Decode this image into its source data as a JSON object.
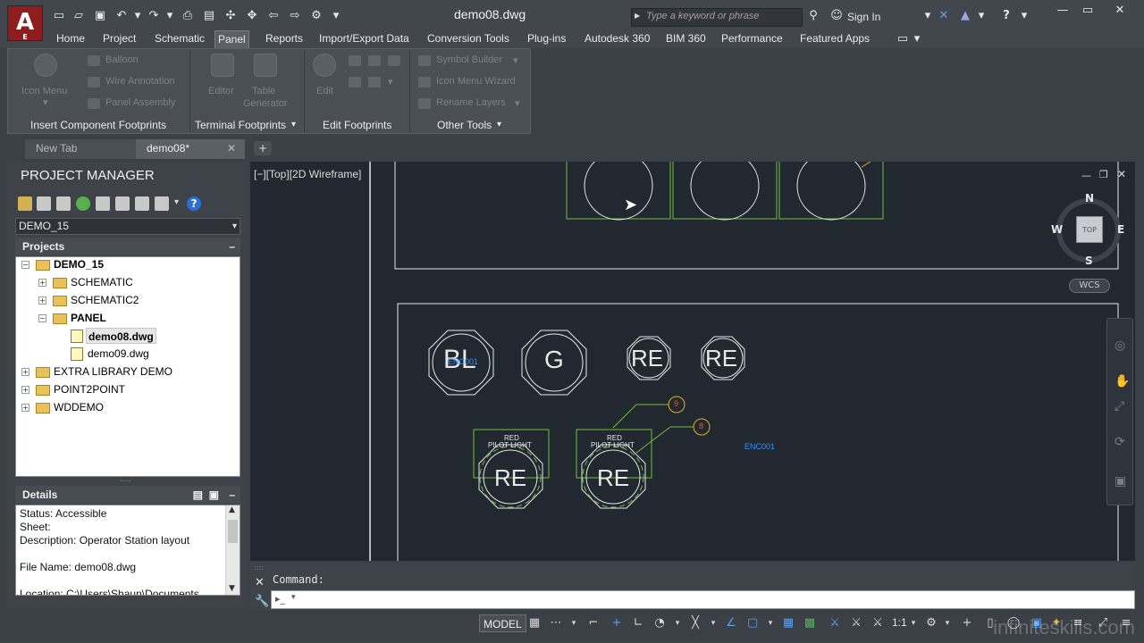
{
  "title_bar": {
    "document_title": "demo08.dwg",
    "search_placeholder": "Type a keyword or phrase",
    "sign_in_label": "Sign In",
    "app_logo_letter": "A",
    "app_logo_sub": "E"
  },
  "menu_tabs": [
    "Home",
    "Project",
    "Schematic",
    "Panel",
    "Reports",
    "Import/Export Data",
    "Conversion Tools",
    "Plug-ins",
    "Autodesk 360",
    "BIM 360",
    "Performance",
    "Featured Apps"
  ],
  "active_tab": "Panel",
  "ribbon": {
    "insert_component": {
      "title": "Insert Component Footprints",
      "icon_menu_label": "Icon Menu",
      "balloon_label": "Balloon",
      "wire_annotation_label": "Wire Annotation",
      "panel_assembly_label": "Panel Assembly"
    },
    "terminal": {
      "title": "Terminal Footprints",
      "editor_label": "Editor",
      "table_label": "Table",
      "generator_label": "Generator"
    },
    "edit": {
      "title": "Edit Footprints",
      "edit_label": "Edit"
    },
    "other": {
      "title": "Other Tools",
      "symbol_builder_label": "Symbol Builder",
      "icon_menu_wizard_label": "Icon Menu  Wizard",
      "rename_layers_label": "Rename  Layers"
    }
  },
  "file_tabs": {
    "new_tab": "New Tab",
    "active_file": "demo08*"
  },
  "project_manager": {
    "title": "PROJECT MANAGER",
    "selected_project": "DEMO_15",
    "projects_header": "Projects",
    "tree": [
      {
        "label": "DEMO_15",
        "bold": true
      },
      {
        "label": "SCHEMATIC",
        "bold": false
      },
      {
        "label": "SCHEMATIC2",
        "bold": false
      },
      {
        "label": "PANEL",
        "bold": true
      },
      {
        "label": "demo08.dwg",
        "bold": true
      },
      {
        "label": "demo09.dwg",
        "bold": false
      },
      {
        "label": "EXTRA LIBRARY DEMO",
        "bold": false
      },
      {
        "label": "POINT2POINT",
        "bold": false
      },
      {
        "label": "WDDEMO",
        "bold": false
      }
    ],
    "details_header": "Details",
    "details": {
      "status": "Status: Accessible",
      "sheet": "Sheet:",
      "description": "Description: Operator Station layout",
      "file_name": "File Name: demo08.dwg",
      "location": "Location: C:\\Users\\Shaun\\Documents"
    }
  },
  "viewport": {
    "label": "[−][Top][2D Wireframe]",
    "viewcube": {
      "north": "N",
      "south": "S",
      "east": "E",
      "west": "W",
      "face": "TOP",
      "ucs": "WCS"
    },
    "symbols": {
      "top_left_text": "BL",
      "top_left_overlay": "ENC001",
      "green_text": "G",
      "red_text_1": "RE",
      "red_text_2": "RE",
      "pilot_1_text": "RE",
      "pilot_2_text": "RE",
      "pilot_label_line1": "RED",
      "pilot_label_line2": "PILOT  LIGHT",
      "balloon_1": "9",
      "balloon_2": "8",
      "enclosure_tag": "ENC001"
    }
  },
  "command_line": {
    "prompt": "Command:"
  },
  "status_bar": {
    "model_label": "MODEL",
    "scale_label": "1:1"
  },
  "watermark": "infiniteskills.com",
  "colors": {
    "canvas_bg": "#212830",
    "line_green": "#6fbf3a",
    "symbol_white": "#e8e8e8",
    "tag_blue": "#3e8ef7",
    "balloon_orange": "#e8b020",
    "logo_red": "#8f1d1d"
  }
}
